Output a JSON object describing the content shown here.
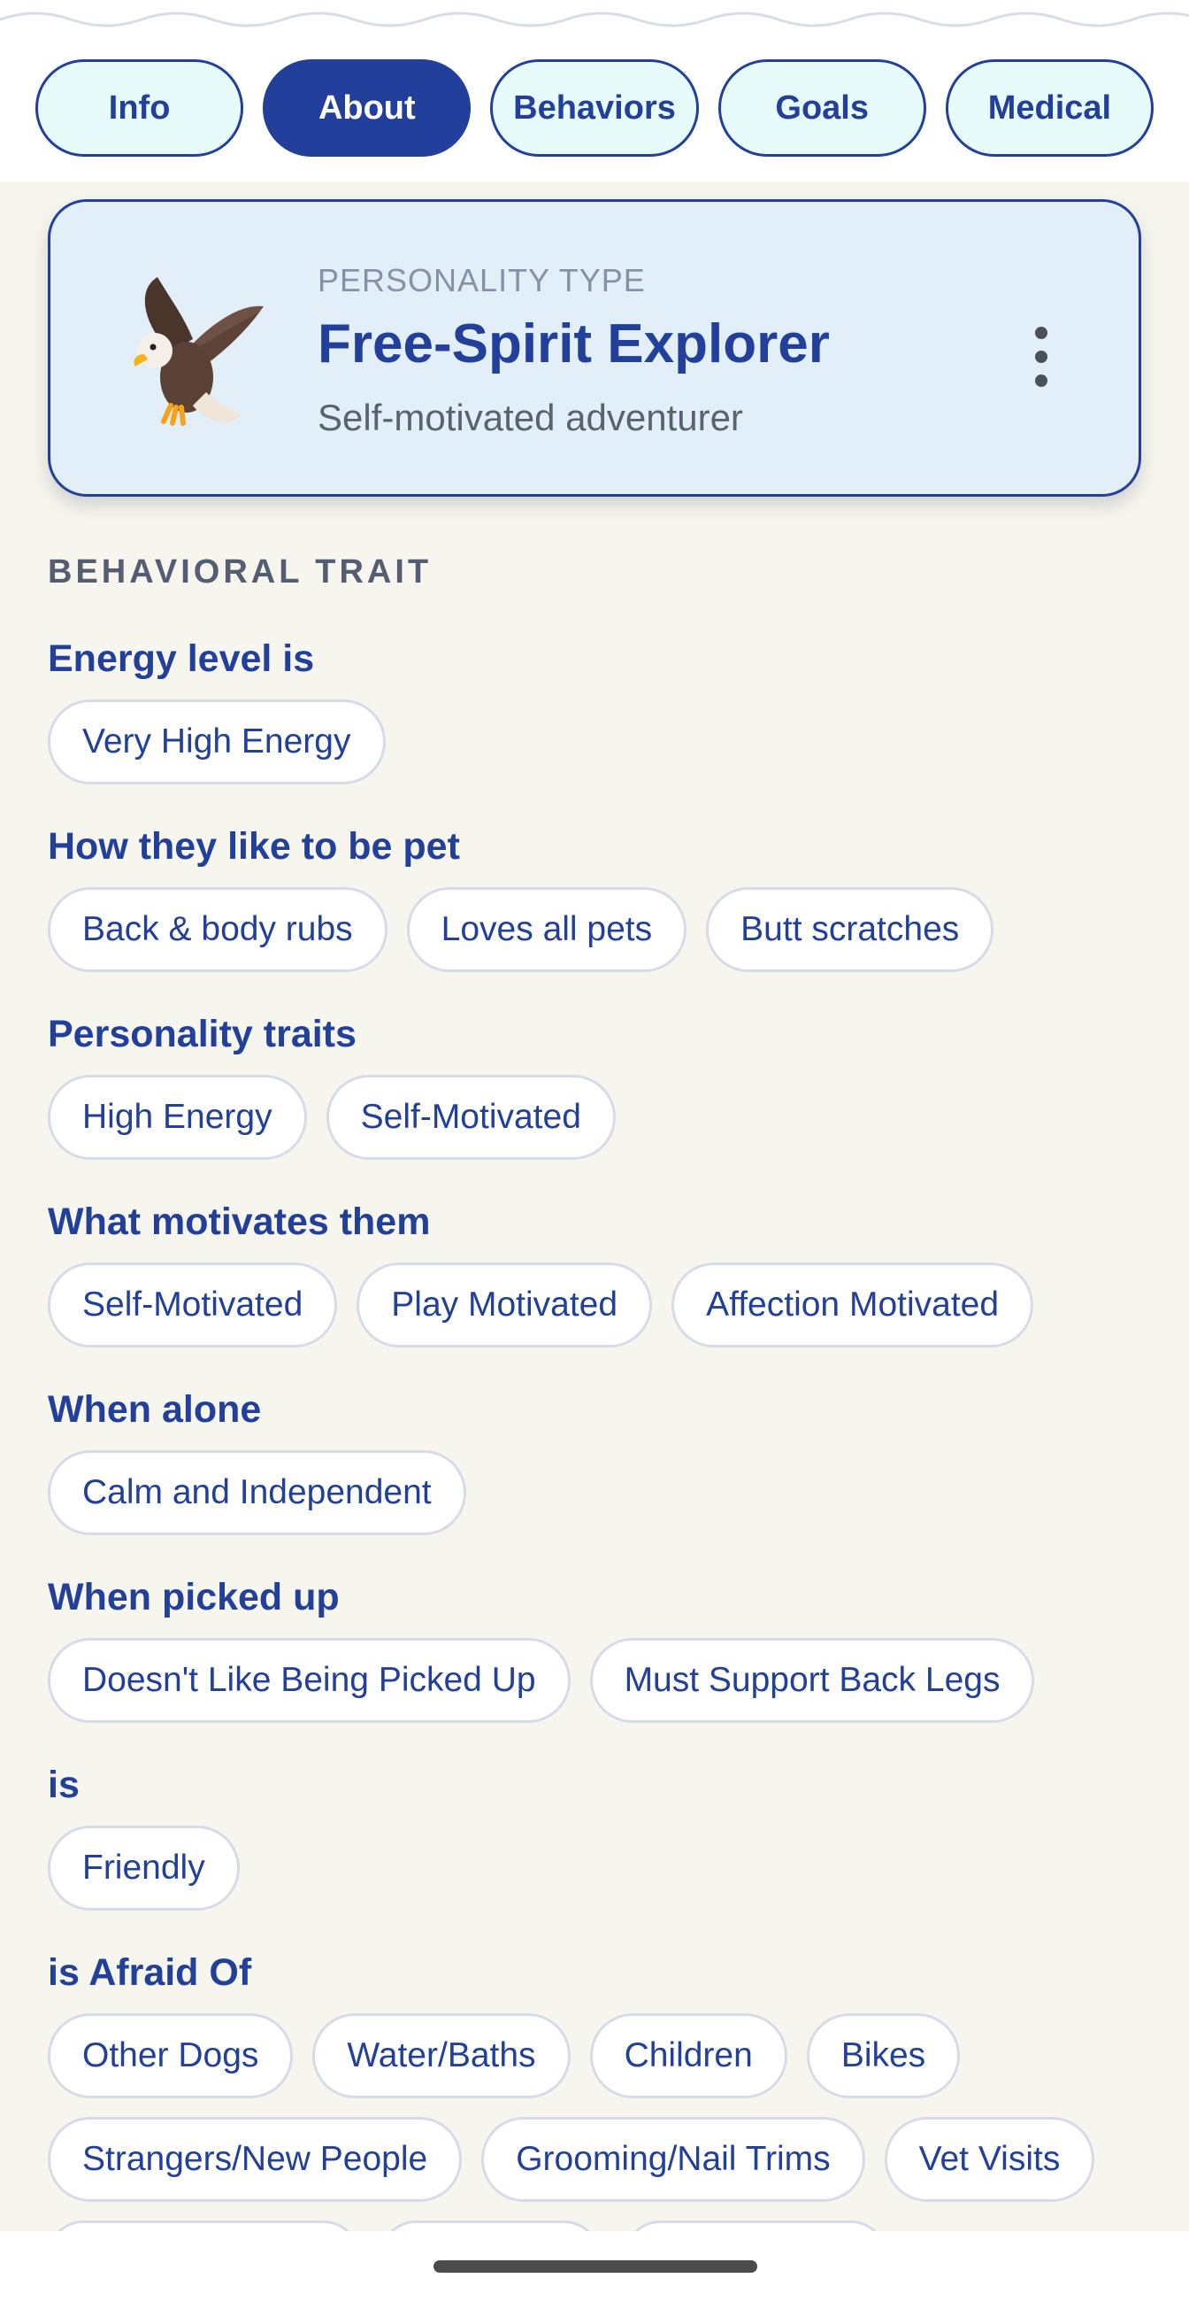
{
  "tabs": [
    {
      "label": "Info",
      "active": false
    },
    {
      "label": "About",
      "active": true
    },
    {
      "label": "Behaviors",
      "active": false
    },
    {
      "label": "Goals",
      "active": false
    },
    {
      "label": "Medical",
      "active": false
    }
  ],
  "personality": {
    "kicker": "PERSONALITY TYPE",
    "title": "Free-Spirit Explorer",
    "subtitle": "Self-motivated adventurer",
    "icon": "eagle-icon"
  },
  "section_label": "BEHAVIORAL TRAIT",
  "groups": [
    {
      "heading": "Energy level is",
      "chips": [
        "Very High Energy"
      ]
    },
    {
      "heading": "How they like to be pet",
      "chips": [
        "Back & body rubs",
        "Loves all pets",
        "Butt scratches"
      ]
    },
    {
      "heading": "Personality traits",
      "chips": [
        "High Energy",
        "Self-Motivated"
      ]
    },
    {
      "heading": "What motivates them",
      "chips": [
        "Self-Motivated",
        "Play Motivated",
        "Affection Motivated"
      ]
    },
    {
      "heading": "When alone",
      "chips": [
        "Calm and Independent"
      ]
    },
    {
      "heading": "When picked up",
      "chips": [
        "Doesn't Like Being Picked Up",
        "Must Support Back Legs"
      ]
    },
    {
      "heading": "is",
      "chips": [
        "Friendly"
      ]
    },
    {
      "heading": "is Afraid Of",
      "chips": [
        "Other Dogs",
        "Water/Baths",
        "Children",
        "Bikes"
      ],
      "chips2": [
        "Strangers/New People",
        "Grooming/Nail Trims",
        "Vet Visits"
      ]
    }
  ],
  "colors": {
    "accent": "#22409a",
    "tab_fill": "#e8fbfb",
    "card_fill": "#e2eef8",
    "background": "#f7f6ee"
  }
}
